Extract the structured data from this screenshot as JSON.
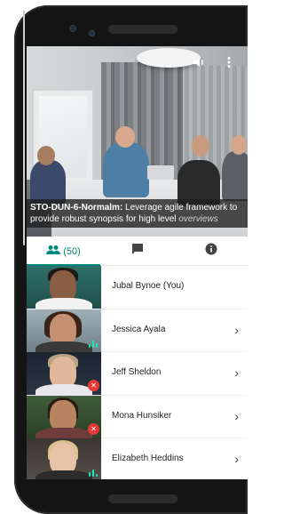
{
  "caption": {
    "speaker": "STO-DUN-6-Normalm:",
    "text": " Leverage agile framework to provide robust synopsis for high level ",
    "emphasis": "overviews"
  },
  "tabs": {
    "people_count": "(50)"
  },
  "participants": [
    {
      "name": "Jubal Bynoe (You)",
      "status": "none"
    },
    {
      "name": "Jessica Ayala",
      "status": "speaking"
    },
    {
      "name": "Jeff Sheldon",
      "status": "muted"
    },
    {
      "name": "Mona Hunsiker",
      "status": "muted"
    },
    {
      "name": "Elizabeth Heddins",
      "status": "speaking"
    }
  ],
  "colors": {
    "accent": "#00897b",
    "muted": "#e53935"
  },
  "icons": {
    "volume": "volume-icon",
    "more": "more-vert-icon",
    "people": "people-icon",
    "chat": "chat-icon",
    "info": "info-icon"
  }
}
